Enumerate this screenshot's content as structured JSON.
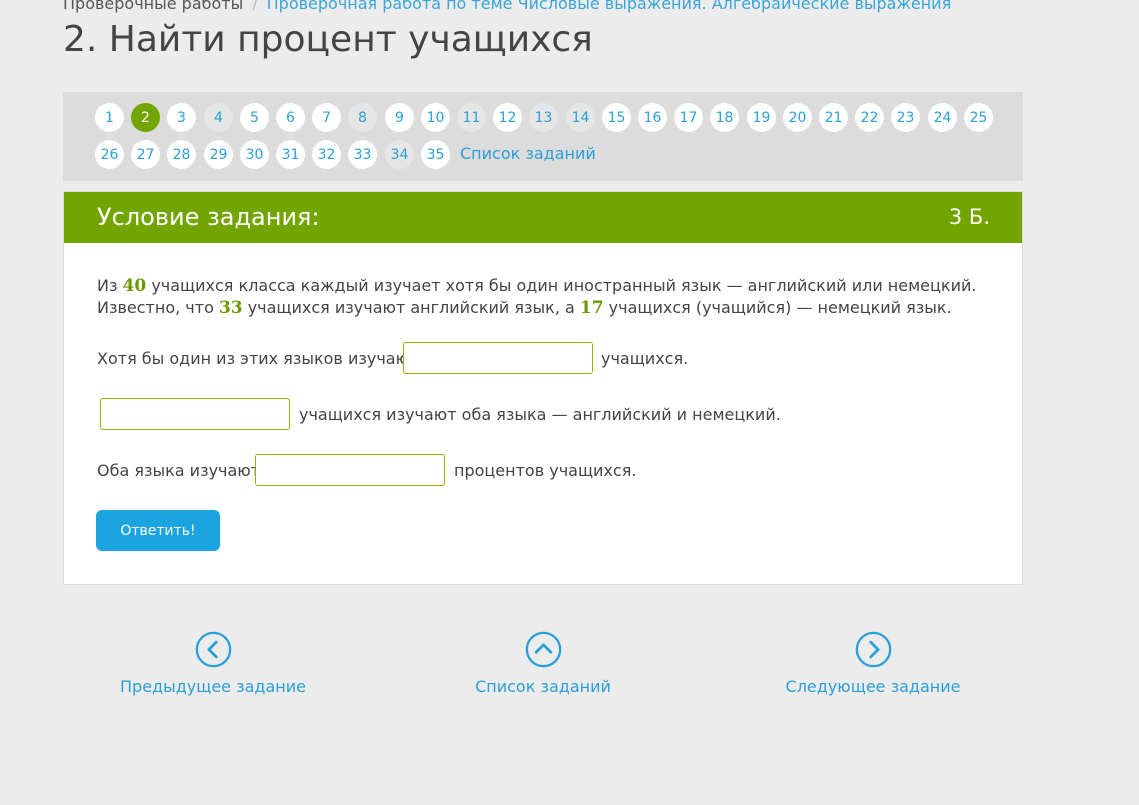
{
  "breadcrumb": {
    "root": "Проверочные работы",
    "current": "Проверочная работа по теме Числовые выражения. Алгебраические выражения"
  },
  "page_title": "2. Найти процент учащихся",
  "nav": {
    "numbers": [
      {
        "label": "1",
        "state": "normal"
      },
      {
        "label": "2",
        "state": "current"
      },
      {
        "label": "3",
        "state": "normal"
      },
      {
        "label": "4",
        "state": "done"
      },
      {
        "label": "5",
        "state": "normal"
      },
      {
        "label": "6",
        "state": "normal"
      },
      {
        "label": "7",
        "state": "normal"
      },
      {
        "label": "8",
        "state": "done"
      },
      {
        "label": "9",
        "state": "normal"
      },
      {
        "label": "10",
        "state": "normal"
      },
      {
        "label": "11",
        "state": "done"
      },
      {
        "label": "12",
        "state": "normal"
      },
      {
        "label": "13",
        "state": "done"
      },
      {
        "label": "14",
        "state": "done"
      },
      {
        "label": "15",
        "state": "normal"
      },
      {
        "label": "16",
        "state": "normal"
      },
      {
        "label": "17",
        "state": "normal"
      },
      {
        "label": "18",
        "state": "normal"
      },
      {
        "label": "19",
        "state": "normal"
      },
      {
        "label": "20",
        "state": "normal"
      },
      {
        "label": "21",
        "state": "normal"
      },
      {
        "label": "22",
        "state": "normal"
      },
      {
        "label": "23",
        "state": "normal"
      },
      {
        "label": "24",
        "state": "normal"
      },
      {
        "label": "25",
        "state": "normal"
      },
      {
        "label": "26",
        "state": "normal"
      },
      {
        "label": "27",
        "state": "normal"
      },
      {
        "label": "28",
        "state": "normal"
      },
      {
        "label": "29",
        "state": "normal"
      },
      {
        "label": "30",
        "state": "normal"
      },
      {
        "label": "31",
        "state": "normal"
      },
      {
        "label": "32",
        "state": "normal"
      },
      {
        "label": "33",
        "state": "normal"
      },
      {
        "label": "34",
        "state": "done"
      },
      {
        "label": "35",
        "state": "normal"
      }
    ],
    "task_list_link": "Список заданий"
  },
  "card": {
    "title": "Условие задания:",
    "points": "3 Б.",
    "text": {
      "p1": "Из ",
      "n1": "40",
      "p2": " учащихся класса каждый изучает хотя бы один иностранный язык — английский или немецкий. Известно, что ",
      "n2": "33",
      "p3": " учащихся изучают английский язык, а ",
      "n3": "17",
      "p4": " учащихся (учащийся) —  немецкий язык."
    },
    "q1": {
      "before": "Хотя бы один из этих языков изучают",
      "after": "учащихся.",
      "value": ""
    },
    "q2": {
      "after": "учащихся изучают оба языка — английский и немецкий.",
      "value": ""
    },
    "q3": {
      "before": "Оба языка изучают",
      "after": "процентов учащихся.",
      "value": ""
    },
    "submit_label": "Ответить!"
  },
  "bottom_nav": {
    "prev": {
      "label": "Предыдущее задание",
      "icon": "chevron-left-circle-icon"
    },
    "list": {
      "label": "Список заданий",
      "icon": "chevron-up-circle-icon"
    },
    "next": {
      "label": "Следующее задание",
      "icon": "chevron-right-circle-icon"
    }
  },
  "colors": {
    "accent_green": "#72a500",
    "link_blue": "#2ba0d8",
    "button_blue": "#1ba4e0",
    "background": "#ececec"
  }
}
